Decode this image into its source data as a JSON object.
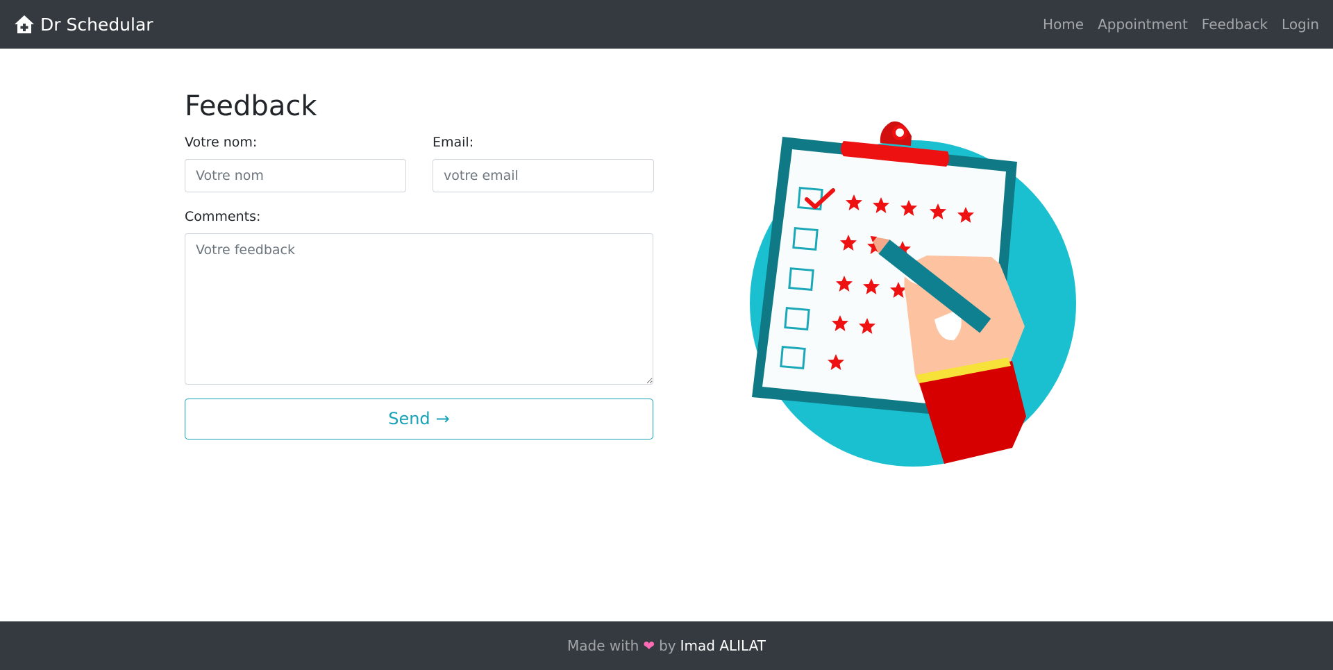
{
  "navbar": {
    "brand": "Dr Schedular",
    "links": [
      "Home",
      "Appointment",
      "Feedback",
      "Login"
    ]
  },
  "form": {
    "title": "Feedback",
    "name_label": "Votre nom:",
    "name_placeholder": "Votre nom",
    "email_label": "Email:",
    "email_placeholder": "votre email",
    "comments_label": "Comments:",
    "comments_placeholder": "Votre feedback",
    "send_label": "Send",
    "send_arrow": "→"
  },
  "footer": {
    "prefix": "Made with",
    "heart": "❤",
    "by": "by",
    "author": "Imad ALILAT"
  },
  "colors": {
    "navbar": "#343a40",
    "accent": "#17a2b8",
    "heart": "#ff6bb5",
    "star": "#ee1111",
    "circle": "#1ac0d0"
  },
  "icons": {
    "brand": "house-medical-icon"
  }
}
